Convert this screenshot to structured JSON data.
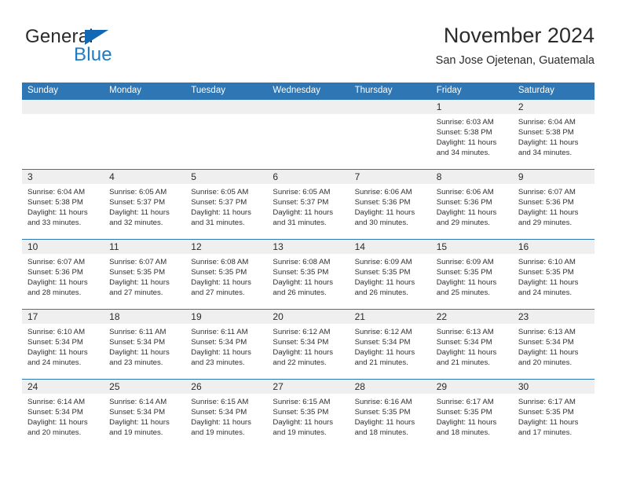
{
  "brand": {
    "name_part1": "General",
    "name_part2": "Blue",
    "triangle_color": "#1268b3",
    "blue_text_color": "#1f7ac4"
  },
  "header": {
    "title": "November 2024",
    "subtitle": "San Jose Ojetenan, Guatemala"
  },
  "theme": {
    "header_blue": "#2f76b4",
    "number_band_gray": "#efefef",
    "text_color": "#2b2b2b"
  },
  "weekday_headers": [
    "Sunday",
    "Monday",
    "Tuesday",
    "Wednesday",
    "Thursday",
    "Friday",
    "Saturday"
  ],
  "weeks": [
    [
      {
        "day": "",
        "sunrise": "",
        "sunset": "",
        "daylight_line1": "",
        "daylight_line2": ""
      },
      {
        "day": "",
        "sunrise": "",
        "sunset": "",
        "daylight_line1": "",
        "daylight_line2": ""
      },
      {
        "day": "",
        "sunrise": "",
        "sunset": "",
        "daylight_line1": "",
        "daylight_line2": ""
      },
      {
        "day": "",
        "sunrise": "",
        "sunset": "",
        "daylight_line1": "",
        "daylight_line2": ""
      },
      {
        "day": "",
        "sunrise": "",
        "sunset": "",
        "daylight_line1": "",
        "daylight_line2": ""
      },
      {
        "day": "1",
        "sunrise": "Sunrise: 6:03 AM",
        "sunset": "Sunset: 5:38 PM",
        "daylight_line1": "Daylight: 11 hours",
        "daylight_line2": "and 34 minutes."
      },
      {
        "day": "2",
        "sunrise": "Sunrise: 6:04 AM",
        "sunset": "Sunset: 5:38 PM",
        "daylight_line1": "Daylight: 11 hours",
        "daylight_line2": "and 34 minutes."
      }
    ],
    [
      {
        "day": "3",
        "sunrise": "Sunrise: 6:04 AM",
        "sunset": "Sunset: 5:38 PM",
        "daylight_line1": "Daylight: 11 hours",
        "daylight_line2": "and 33 minutes."
      },
      {
        "day": "4",
        "sunrise": "Sunrise: 6:05 AM",
        "sunset": "Sunset: 5:37 PM",
        "daylight_line1": "Daylight: 11 hours",
        "daylight_line2": "and 32 minutes."
      },
      {
        "day": "5",
        "sunrise": "Sunrise: 6:05 AM",
        "sunset": "Sunset: 5:37 PM",
        "daylight_line1": "Daylight: 11 hours",
        "daylight_line2": "and 31 minutes."
      },
      {
        "day": "6",
        "sunrise": "Sunrise: 6:05 AM",
        "sunset": "Sunset: 5:37 PM",
        "daylight_line1": "Daylight: 11 hours",
        "daylight_line2": "and 31 minutes."
      },
      {
        "day": "7",
        "sunrise": "Sunrise: 6:06 AM",
        "sunset": "Sunset: 5:36 PM",
        "daylight_line1": "Daylight: 11 hours",
        "daylight_line2": "and 30 minutes."
      },
      {
        "day": "8",
        "sunrise": "Sunrise: 6:06 AM",
        "sunset": "Sunset: 5:36 PM",
        "daylight_line1": "Daylight: 11 hours",
        "daylight_line2": "and 29 minutes."
      },
      {
        "day": "9",
        "sunrise": "Sunrise: 6:07 AM",
        "sunset": "Sunset: 5:36 PM",
        "daylight_line1": "Daylight: 11 hours",
        "daylight_line2": "and 29 minutes."
      }
    ],
    [
      {
        "day": "10",
        "sunrise": "Sunrise: 6:07 AM",
        "sunset": "Sunset: 5:36 PM",
        "daylight_line1": "Daylight: 11 hours",
        "daylight_line2": "and 28 minutes."
      },
      {
        "day": "11",
        "sunrise": "Sunrise: 6:07 AM",
        "sunset": "Sunset: 5:35 PM",
        "daylight_line1": "Daylight: 11 hours",
        "daylight_line2": "and 27 minutes."
      },
      {
        "day": "12",
        "sunrise": "Sunrise: 6:08 AM",
        "sunset": "Sunset: 5:35 PM",
        "daylight_line1": "Daylight: 11 hours",
        "daylight_line2": "and 27 minutes."
      },
      {
        "day": "13",
        "sunrise": "Sunrise: 6:08 AM",
        "sunset": "Sunset: 5:35 PM",
        "daylight_line1": "Daylight: 11 hours",
        "daylight_line2": "and 26 minutes."
      },
      {
        "day": "14",
        "sunrise": "Sunrise: 6:09 AM",
        "sunset": "Sunset: 5:35 PM",
        "daylight_line1": "Daylight: 11 hours",
        "daylight_line2": "and 26 minutes."
      },
      {
        "day": "15",
        "sunrise": "Sunrise: 6:09 AM",
        "sunset": "Sunset: 5:35 PM",
        "daylight_line1": "Daylight: 11 hours",
        "daylight_line2": "and 25 minutes."
      },
      {
        "day": "16",
        "sunrise": "Sunrise: 6:10 AM",
        "sunset": "Sunset: 5:35 PM",
        "daylight_line1": "Daylight: 11 hours",
        "daylight_line2": "and 24 minutes."
      }
    ],
    [
      {
        "day": "17",
        "sunrise": "Sunrise: 6:10 AM",
        "sunset": "Sunset: 5:34 PM",
        "daylight_line1": "Daylight: 11 hours",
        "daylight_line2": "and 24 minutes."
      },
      {
        "day": "18",
        "sunrise": "Sunrise: 6:11 AM",
        "sunset": "Sunset: 5:34 PM",
        "daylight_line1": "Daylight: 11 hours",
        "daylight_line2": "and 23 minutes."
      },
      {
        "day": "19",
        "sunrise": "Sunrise: 6:11 AM",
        "sunset": "Sunset: 5:34 PM",
        "daylight_line1": "Daylight: 11 hours",
        "daylight_line2": "and 23 minutes."
      },
      {
        "day": "20",
        "sunrise": "Sunrise: 6:12 AM",
        "sunset": "Sunset: 5:34 PM",
        "daylight_line1": "Daylight: 11 hours",
        "daylight_line2": "and 22 minutes."
      },
      {
        "day": "21",
        "sunrise": "Sunrise: 6:12 AM",
        "sunset": "Sunset: 5:34 PM",
        "daylight_line1": "Daylight: 11 hours",
        "daylight_line2": "and 21 minutes."
      },
      {
        "day": "22",
        "sunrise": "Sunrise: 6:13 AM",
        "sunset": "Sunset: 5:34 PM",
        "daylight_line1": "Daylight: 11 hours",
        "daylight_line2": "and 21 minutes."
      },
      {
        "day": "23",
        "sunrise": "Sunrise: 6:13 AM",
        "sunset": "Sunset: 5:34 PM",
        "daylight_line1": "Daylight: 11 hours",
        "daylight_line2": "and 20 minutes."
      }
    ],
    [
      {
        "day": "24",
        "sunrise": "Sunrise: 6:14 AM",
        "sunset": "Sunset: 5:34 PM",
        "daylight_line1": "Daylight: 11 hours",
        "daylight_line2": "and 20 minutes."
      },
      {
        "day": "25",
        "sunrise": "Sunrise: 6:14 AM",
        "sunset": "Sunset: 5:34 PM",
        "daylight_line1": "Daylight: 11 hours",
        "daylight_line2": "and 19 minutes."
      },
      {
        "day": "26",
        "sunrise": "Sunrise: 6:15 AM",
        "sunset": "Sunset: 5:34 PM",
        "daylight_line1": "Daylight: 11 hours",
        "daylight_line2": "and 19 minutes."
      },
      {
        "day": "27",
        "sunrise": "Sunrise: 6:15 AM",
        "sunset": "Sunset: 5:35 PM",
        "daylight_line1": "Daylight: 11 hours",
        "daylight_line2": "and 19 minutes."
      },
      {
        "day": "28",
        "sunrise": "Sunrise: 6:16 AM",
        "sunset": "Sunset: 5:35 PM",
        "daylight_line1": "Daylight: 11 hours",
        "daylight_line2": "and 18 minutes."
      },
      {
        "day": "29",
        "sunrise": "Sunrise: 6:17 AM",
        "sunset": "Sunset: 5:35 PM",
        "daylight_line1": "Daylight: 11 hours",
        "daylight_line2": "and 18 minutes."
      },
      {
        "day": "30",
        "sunrise": "Sunrise: 6:17 AM",
        "sunset": "Sunset: 5:35 PM",
        "daylight_line1": "Daylight: 11 hours",
        "daylight_line2": "and 17 minutes."
      }
    ]
  ]
}
